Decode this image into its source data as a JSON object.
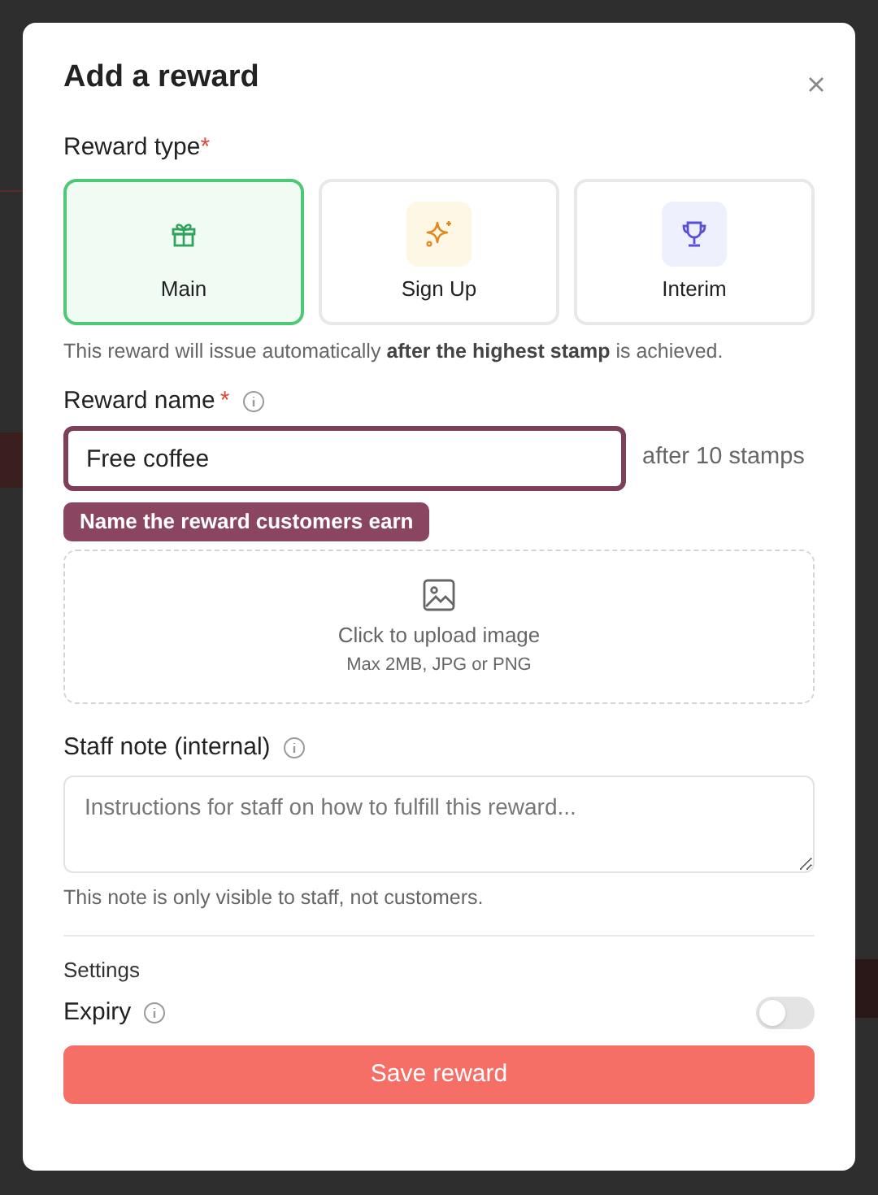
{
  "dialog": {
    "title": "Add a reward"
  },
  "reward_type": {
    "label": "Reward type",
    "required_mark": "*",
    "options": [
      {
        "kind": "gift",
        "label": "Main",
        "selected": true
      },
      {
        "kind": "sparkle",
        "label": "Sign Up",
        "selected": false
      },
      {
        "kind": "trophy",
        "label": "Interim",
        "selected": false
      }
    ],
    "hint": "This reward will issue automatically **after the highest stamp** is achieved."
  },
  "reward_name": {
    "label": "Reward name",
    "required_mark": "*",
    "value": "Free coffee",
    "suffix": "after 10 stamps",
    "tooltip": "Name the reward customers earn"
  },
  "upload": {
    "title": "Click to upload image",
    "subtitle": "Max 2MB, JPG or PNG"
  },
  "staff_note": {
    "label": "Staff note (internal)",
    "placeholder": "Instructions for staff on how to fulfill this reward...",
    "hint": "This note is only visible to staff, not customers."
  },
  "settings": {
    "heading": "Settings",
    "items": [
      {
        "label": "Expiry",
        "on": false
      }
    ]
  },
  "save_button": {
    "label": "Save reward"
  }
}
